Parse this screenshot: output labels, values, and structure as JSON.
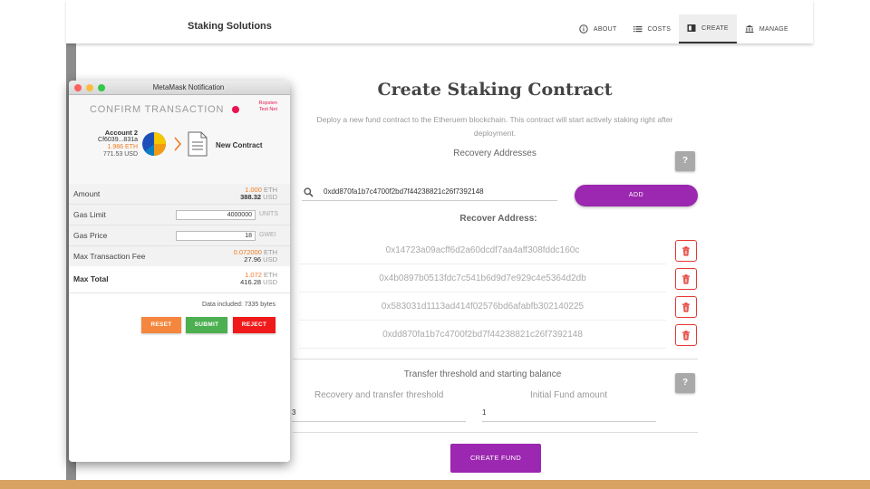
{
  "app": {
    "brand": "Staking Solutions",
    "nav": [
      {
        "label": "ABOUT",
        "icon": "info-icon"
      },
      {
        "label": "COSTS",
        "icon": "list-icon"
      },
      {
        "label": "CREATE",
        "icon": "contract-icon",
        "active": true
      },
      {
        "label": "MANAGE",
        "icon": "bank-icon"
      }
    ]
  },
  "main": {
    "title": "Create Staking Contract",
    "description": "Deploy a new fund contract to the Etheruem blockchain. This contract will start actively staking right after deployment.",
    "recovery_section": "Recovery Addresses",
    "help_label": "?",
    "search_value": "0xdd870fa1b7c4700f2bd7f44238821c26f7392148",
    "add_label": "ADD",
    "list_header": "Recover Address:",
    "addresses": [
      "0x14723a09acff6d2a60dcdf7aa4aff308fddc160c",
      "0x4b0897b0513fdc7c541b6d9d7e929c4e5364d2db",
      "0x583031d1113ad414f02576bd6afabfb302140225",
      "0xdd870fa1b7c4700f2bd7f44238821c26f7392148"
    ],
    "transfer_section": "Transfer threshold and starting balance",
    "threshold_label": "Recovery and transfer threshold",
    "threshold_value": "3",
    "fund_label": "Initial Fund amount",
    "fund_value": "1",
    "create_label": "CREATE FUND"
  },
  "metamask": {
    "window_title": "MetaMask Notification",
    "header": "CONFIRM TRANSACTION",
    "network_line1": "Ropsten",
    "network_line2": "Test Net",
    "account_name": "Account 2",
    "account_addr": "Cf6039...831a",
    "account_eth": "1.986 ETH",
    "account_usd": "771.53 USD",
    "target": "New Contract",
    "amount_label": "Amount",
    "amount_eth": "1.000",
    "amount_eth_unit": "ETH",
    "amount_usd": "388.32",
    "amount_usd_unit": "USD",
    "gas_limit_label": "Gas Limit",
    "gas_limit_value": "4000000",
    "gas_limit_unit": "UNITS",
    "gas_price_label": "Gas Price",
    "gas_price_value": "18",
    "gas_price_unit": "GWEI",
    "max_fee_label": "Max Transaction Fee",
    "max_fee_eth": "0.072000",
    "max_fee_eth_unit": "ETH",
    "max_fee_usd": "27.96",
    "max_fee_usd_unit": "USD",
    "max_total_label": "Max Total",
    "max_total_eth": "1.072",
    "max_total_eth_unit": "ETH",
    "max_total_usd": "416.28",
    "max_total_usd_unit": "USD",
    "data_included": "Data included: 7335 bytes",
    "reset_label": "RESET",
    "submit_label": "SUBMIT",
    "reject_label": "REJECT"
  },
  "colors": {
    "accent": "#9c27b0",
    "delete": "#e53935",
    "eth_orange": "#f07b23",
    "submit_green": "#4caf50",
    "reject_red": "#f01a1a",
    "reset_orange": "#f4863d",
    "footer_bar": "#d8a263"
  }
}
